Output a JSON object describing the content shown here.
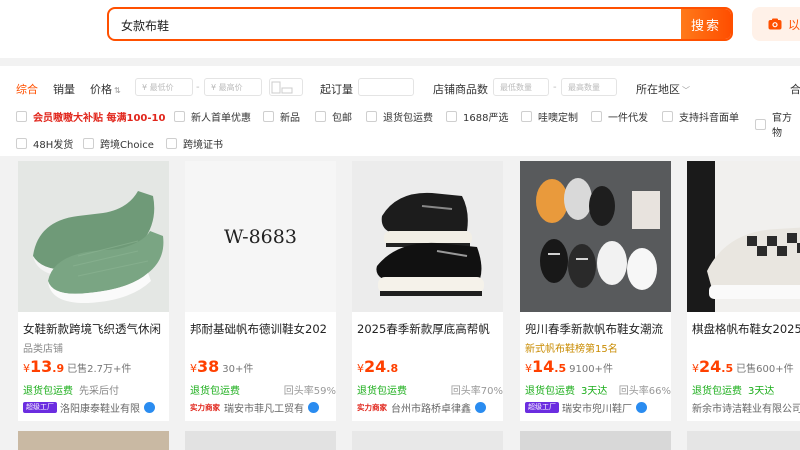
{
  "search": {
    "query": "女款布鞋",
    "button": "搜索",
    "camera_label": "以"
  },
  "sort_tabs": [
    "综合",
    "销量",
    "价格"
  ],
  "price_filter": {
    "min_placeholder": "¥ 最低价",
    "max_placeholder": "¥ 最高价"
  },
  "filter_labels": {
    "min_order": "起订量",
    "shop_count": "店铺商品数",
    "count_min": "最低数量",
    "count_max": "最高数量",
    "region": "所在地区",
    "cut_off": "合"
  },
  "promo_options": [
    "会员嗷嗷大补贴 每满100-10",
    "新人首单优惠",
    "新品",
    "包邮",
    "退货包运费",
    "1688严选",
    "哇噢定制",
    "一件代发",
    "支持抖音面单",
    "官方物"
  ],
  "extra_options": [
    "48H发货",
    "跨境Choice",
    "跨境证书"
  ],
  "products": [
    {
      "title": "女鞋新款跨境飞织透气休闲",
      "sub": "品类店铺",
      "price_int": "13",
      "price_dec": ".9",
      "sold": "已售2.7万+件",
      "svc1": "退货包运费",
      "svc2": "先采后付",
      "rate": "",
      "badge": "超级工厂",
      "shop": "洛阳康泰鞋业有限"
    },
    {
      "title": "邦耐基础帆布德训鞋女202",
      "sub": "",
      "price_int": "38",
      "price_dec": "",
      "sold": "30+件",
      "svc1": "退货包运费",
      "svc2": "",
      "rate": "回头率59%",
      "badge": "实力商家",
      "shop": "瑞安市菲凡工贸有",
      "img_text": "W-8683"
    },
    {
      "title": "2025春季新款厚底高帮帆",
      "sub": "",
      "price_int": "24",
      "price_dec": ".8",
      "sold": "",
      "svc1": "退货包运费",
      "svc2": "",
      "rate": "回头率70%",
      "badge": "实力商家",
      "shop": "台州市路桥卓律鑫"
    },
    {
      "title": "兜川春季新款帆布鞋女潮流",
      "sub": "新式帆布鞋榜第15名",
      "price_int": "14",
      "price_dec": ".5",
      "sold": "9100+件",
      "svc1": "退货包运费",
      "svc2": "3天达",
      "rate": "回头率66%",
      "badge": "超级工厂",
      "shop": "瑞安市兜川鞋厂"
    },
    {
      "title": "棋盘格帆布鞋女2025",
      "sub": "",
      "price_int": "24",
      "price_dec": ".5",
      "sold": "已售600+件",
      "svc1": "退货包运费",
      "svc2": "3天达",
      "rate": "",
      "badge": "",
      "shop": "新余市诗洁鞋业有限公司"
    }
  ]
}
